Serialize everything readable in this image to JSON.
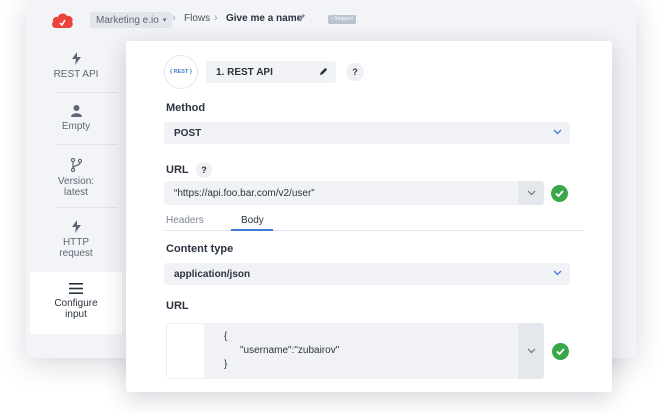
{
  "header": {
    "project": "Marketing e.io",
    "breadcrumbs": [
      "Flows",
      "Give me a name"
    ],
    "tag": "• Stopped"
  },
  "sidebar": {
    "items": [
      {
        "label": "REST API",
        "icon": "bolt-icon"
      },
      {
        "label": "Empty",
        "icon": "user-icon"
      },
      {
        "label": "Version: latest",
        "icon": "branch-icon"
      },
      {
        "label": "HTTP request",
        "icon": "bolt-icon"
      },
      {
        "label": "Configure input",
        "icon": "menu-icon",
        "active": true
      }
    ]
  },
  "step": {
    "badge": "{ REST }",
    "name": "1. REST API",
    "help": "?"
  },
  "method": {
    "label": "Method",
    "value": "POST"
  },
  "url": {
    "label": "URL",
    "help": "?",
    "value": "“https://api.foo.bar.com/v2/user”"
  },
  "tabs": [
    {
      "label": "Headers",
      "active": false
    },
    {
      "label": "Body",
      "active": true
    }
  ],
  "content_type": {
    "label": "Content type",
    "value": "application/json"
  },
  "body": {
    "label": "URL",
    "lines": [
      "{",
      "\"username\":\"zubairov\"",
      "}"
    ]
  },
  "colors": {
    "accent": "#3d7fd6",
    "success": "#3aa84a",
    "logo": "#e8443a"
  }
}
